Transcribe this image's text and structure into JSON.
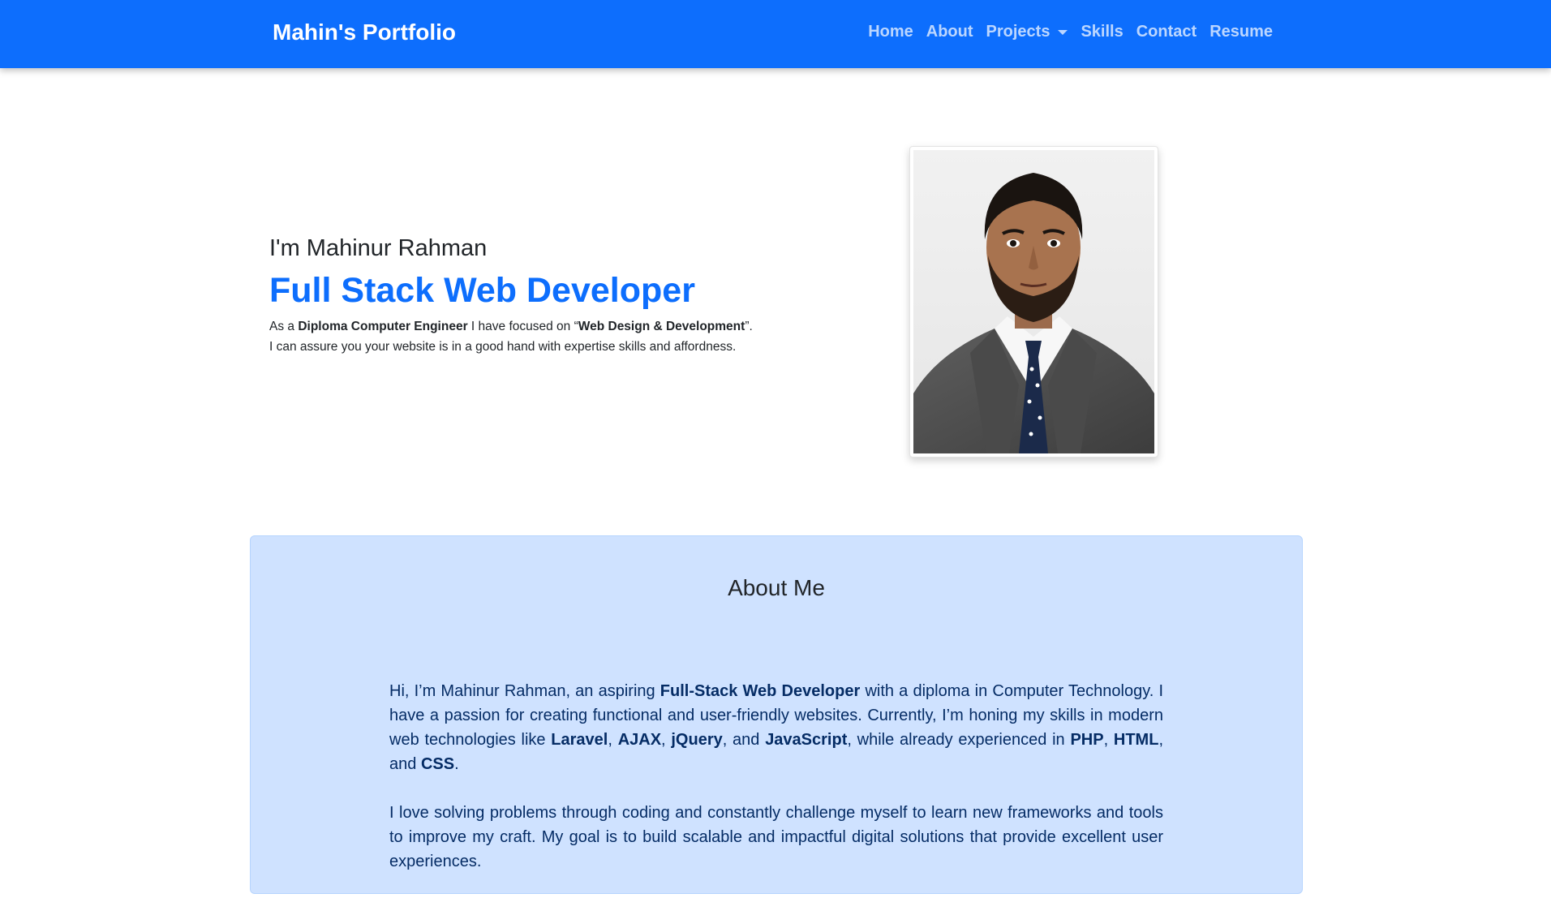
{
  "nav": {
    "brand": "Mahin's Portfolio",
    "links": [
      "Home",
      "About",
      "Projects",
      "Skills",
      "Contact",
      "Resume"
    ]
  },
  "hero": {
    "greeting": "I'm Mahinur Rahman",
    "title": "Full Stack Web Developer",
    "desc_line1": {
      "pre": "As a ",
      "bold1": "Diploma Computer Engineer",
      "mid": " I have focused on “",
      "bold2": "Web Design & Development",
      "post": "”."
    },
    "desc_line2": "I can assure you your website is in a good hand with expertise skills and affordness."
  },
  "about": {
    "title": "About Me",
    "p1": {
      "t1": "Hi, I’m Mahinur Rahman, an aspiring ",
      "b1": "Full-Stack Web Developer",
      "t2": " with a diploma in Computer Technology. I have a passion for creating functional and user-friendly websites. Currently, I’m honing my skills in modern web technologies like ",
      "b2": "Laravel",
      "t3": ", ",
      "b3": "AJAX",
      "t4": ", ",
      "b4": "jQuery",
      "t5": ", and ",
      "b5": "JavaScript",
      "t6": ", while already experienced in ",
      "b6": "PHP",
      "t7": ", ",
      "b7": "HTML",
      "t8": ", and ",
      "b8": "CSS",
      "t9": "."
    },
    "p2": "I love solving problems through coding and constantly challenge myself to learn new frameworks and tools to improve my craft. My goal is to build scalable and impactful digital solutions that provide excellent user experiences."
  },
  "colors": {
    "primary": "#0d6efd",
    "about_bg": "#cfe2ff",
    "about_text": "#052c65"
  }
}
